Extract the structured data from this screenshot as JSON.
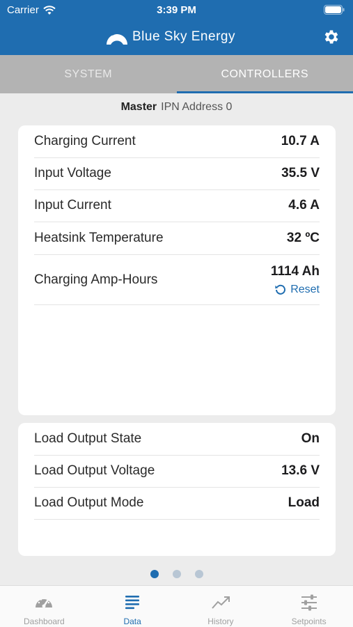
{
  "status_bar": {
    "carrier": "Carrier",
    "time": "3:39 PM"
  },
  "header": {
    "brand": "Blue Sky Energy",
    "settings_icon": "gear-icon",
    "background_color": "#1f6db0"
  },
  "tabs": [
    {
      "label": "SYSTEM",
      "active": false
    },
    {
      "label": "CONTROLLERS",
      "active": true
    }
  ],
  "controller": {
    "role": "Master",
    "address": "IPN Address 0"
  },
  "charging_card": {
    "rows": [
      {
        "label": "Charging Current",
        "value": "10.7 A"
      },
      {
        "label": "Input Voltage",
        "value": "35.5 V"
      },
      {
        "label": "Input Current",
        "value": "4.6 A"
      },
      {
        "label": "Heatsink Temperature",
        "value": "32 ºC"
      },
      {
        "label": "Charging Amp-Hours",
        "value": "1114 Ah"
      }
    ],
    "reset_label": "Reset"
  },
  "load_card": {
    "rows": [
      {
        "label": "Load Output State",
        "value": "On"
      },
      {
        "label": "Load Output Voltage",
        "value": "13.6 V"
      },
      {
        "label": "Load Output Mode",
        "value": "Load"
      }
    ]
  },
  "pager": {
    "pages": 3,
    "current": 1
  },
  "bottom_tabs": [
    {
      "label": "Dashboard",
      "icon": "gauge-icon",
      "active": false
    },
    {
      "label": "Data",
      "icon": "list-icon",
      "active": true
    },
    {
      "label": "History",
      "icon": "trend-icon",
      "active": false
    },
    {
      "label": "Setpoints",
      "icon": "sliders-icon",
      "active": false
    }
  ]
}
